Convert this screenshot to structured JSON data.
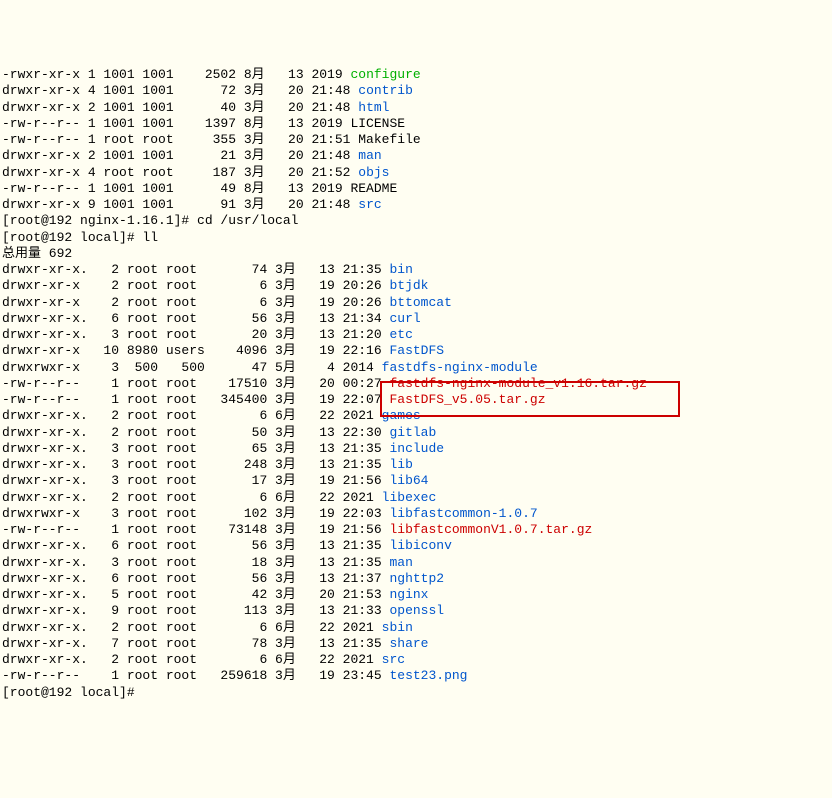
{
  "lines": [
    {
      "perms": "-rwxr-xr-x 1 1001 1001    2502 8月   13 2019 ",
      "name": "configure",
      "cls": "green"
    },
    {
      "perms": "drwxr-xr-x 4 1001 1001      72 3月   20 21:48 ",
      "name": "contrib",
      "cls": "blue"
    },
    {
      "perms": "drwxr-xr-x 2 1001 1001      40 3月   20 21:48 ",
      "name": "html",
      "cls": "blue"
    },
    {
      "perms": "-rw-r--r-- 1 1001 1001    1397 8月   13 2019 LICENSE",
      "name": "",
      "cls": ""
    },
    {
      "perms": "-rw-r--r-- 1 root root     355 3月   20 21:51 Makefile",
      "name": "",
      "cls": ""
    },
    {
      "perms": "drwxr-xr-x 2 1001 1001      21 3月   20 21:48 ",
      "name": "man",
      "cls": "blue"
    },
    {
      "perms": "drwxr-xr-x 4 root root     187 3月   20 21:52 ",
      "name": "objs",
      "cls": "blue"
    },
    {
      "perms": "-rw-r--r-- 1 1001 1001      49 8月   13 2019 README",
      "name": "",
      "cls": ""
    },
    {
      "perms": "drwxr-xr-x 9 1001 1001      91 3月   20 21:48 ",
      "name": "src",
      "cls": "blue"
    }
  ],
  "prompt1": "[root@192 nginx-1.16.1]# cd /usr/local",
  "prompt2": "[root@192 local]# ll",
  "total": "总用量 692",
  "rows": [
    {
      "perms": "drwxr-xr-x.   2 root root       74 3月   13 21:35 ",
      "name": "bin",
      "cls": "blue"
    },
    {
      "perms": "drwxr-xr-x    2 root root        6 3月   19 20:26 ",
      "name": "btjdk",
      "cls": "blue"
    },
    {
      "perms": "drwxr-xr-x    2 root root        6 3月   19 20:26 ",
      "name": "bttomcat",
      "cls": "blue"
    },
    {
      "perms": "drwxr-xr-x.   6 root root       56 3月   13 21:34 ",
      "name": "curl",
      "cls": "blue"
    },
    {
      "perms": "drwxr-xr-x.   3 root root       20 3月   13 21:20 ",
      "name": "etc",
      "cls": "blue"
    },
    {
      "perms": "drwxr-xr-x   10 8980 users    4096 3月   19 22:16 ",
      "name": "FastDFS",
      "cls": "blue"
    },
    {
      "perms": "drwxrwxr-x    3  500   500      47 5月    4 2014 ",
      "name": "fastdfs-nginx-module",
      "cls": "blue"
    },
    {
      "perms": "-rw-r--r--    1 root root    17510 3月   20 00:27 ",
      "name": "fastdfs-nginx-module_v1.16.tar.gz",
      "cls": "red"
    },
    {
      "perms": "-rw-r--r--    1 root root   345400 3月   19 22:07 ",
      "name": "FastDFS_v5.05.tar.gz",
      "cls": "red"
    },
    {
      "perms": "drwxr-xr-x.   2 root root        6 6月   22 2021 ",
      "name": "games",
      "cls": "blue"
    },
    {
      "perms": "drwxr-xr-x.   2 root root       50 3月   13 22:30 ",
      "name": "gitlab",
      "cls": "blue"
    },
    {
      "perms": "drwxr-xr-x.   3 root root       65 3月   13 21:35 ",
      "name": "include",
      "cls": "blue"
    },
    {
      "perms": "drwxr-xr-x.   3 root root      248 3月   13 21:35 ",
      "name": "lib",
      "cls": "blue"
    },
    {
      "perms": "drwxr-xr-x.   3 root root       17 3月   19 21:56 ",
      "name": "lib64",
      "cls": "blue"
    },
    {
      "perms": "drwxr-xr-x.   2 root root        6 6月   22 2021 ",
      "name": "libexec",
      "cls": "blue"
    },
    {
      "perms": "drwxrwxr-x    3 root root      102 3月   19 22:03 ",
      "name": "libfastcommon-1.0.7",
      "cls": "blue"
    },
    {
      "perms": "-rw-r--r--    1 root root    73148 3月   19 21:56 ",
      "name": "libfastcommonV1.0.7.tar.gz",
      "cls": "red"
    },
    {
      "perms": "drwxr-xr-x.   6 root root       56 3月   13 21:35 ",
      "name": "libiconv",
      "cls": "blue"
    },
    {
      "perms": "drwxr-xr-x.   3 root root       18 3月   13 21:35 ",
      "name": "man",
      "cls": "blue"
    },
    {
      "perms": "drwxr-xr-x.   6 root root       56 3月   13 21:37 ",
      "name": "nghttp2",
      "cls": "blue"
    },
    {
      "perms": "drwxr-xr-x.   5 root root       42 3月   20 21:53 ",
      "name": "nginx",
      "cls": "blue"
    },
    {
      "perms": "drwxr-xr-x.   9 root root      113 3月   13 21:33 ",
      "name": "openssl",
      "cls": "blue"
    },
    {
      "perms": "drwxr-xr-x.   2 root root        6 6月   22 2021 ",
      "name": "sbin",
      "cls": "blue"
    },
    {
      "perms": "drwxr-xr-x.   7 root root       78 3月   13 21:35 ",
      "name": "share",
      "cls": "blue"
    },
    {
      "perms": "drwxr-xr-x.   2 root root        6 6月   22 2021 ",
      "name": "src",
      "cls": "blue"
    },
    {
      "perms": "-rw-r--r--    1 root root   259618 3月   19 23:45 ",
      "name": "test23.png",
      "cls": "blue"
    }
  ],
  "prompt3": "[root@192 local]#"
}
